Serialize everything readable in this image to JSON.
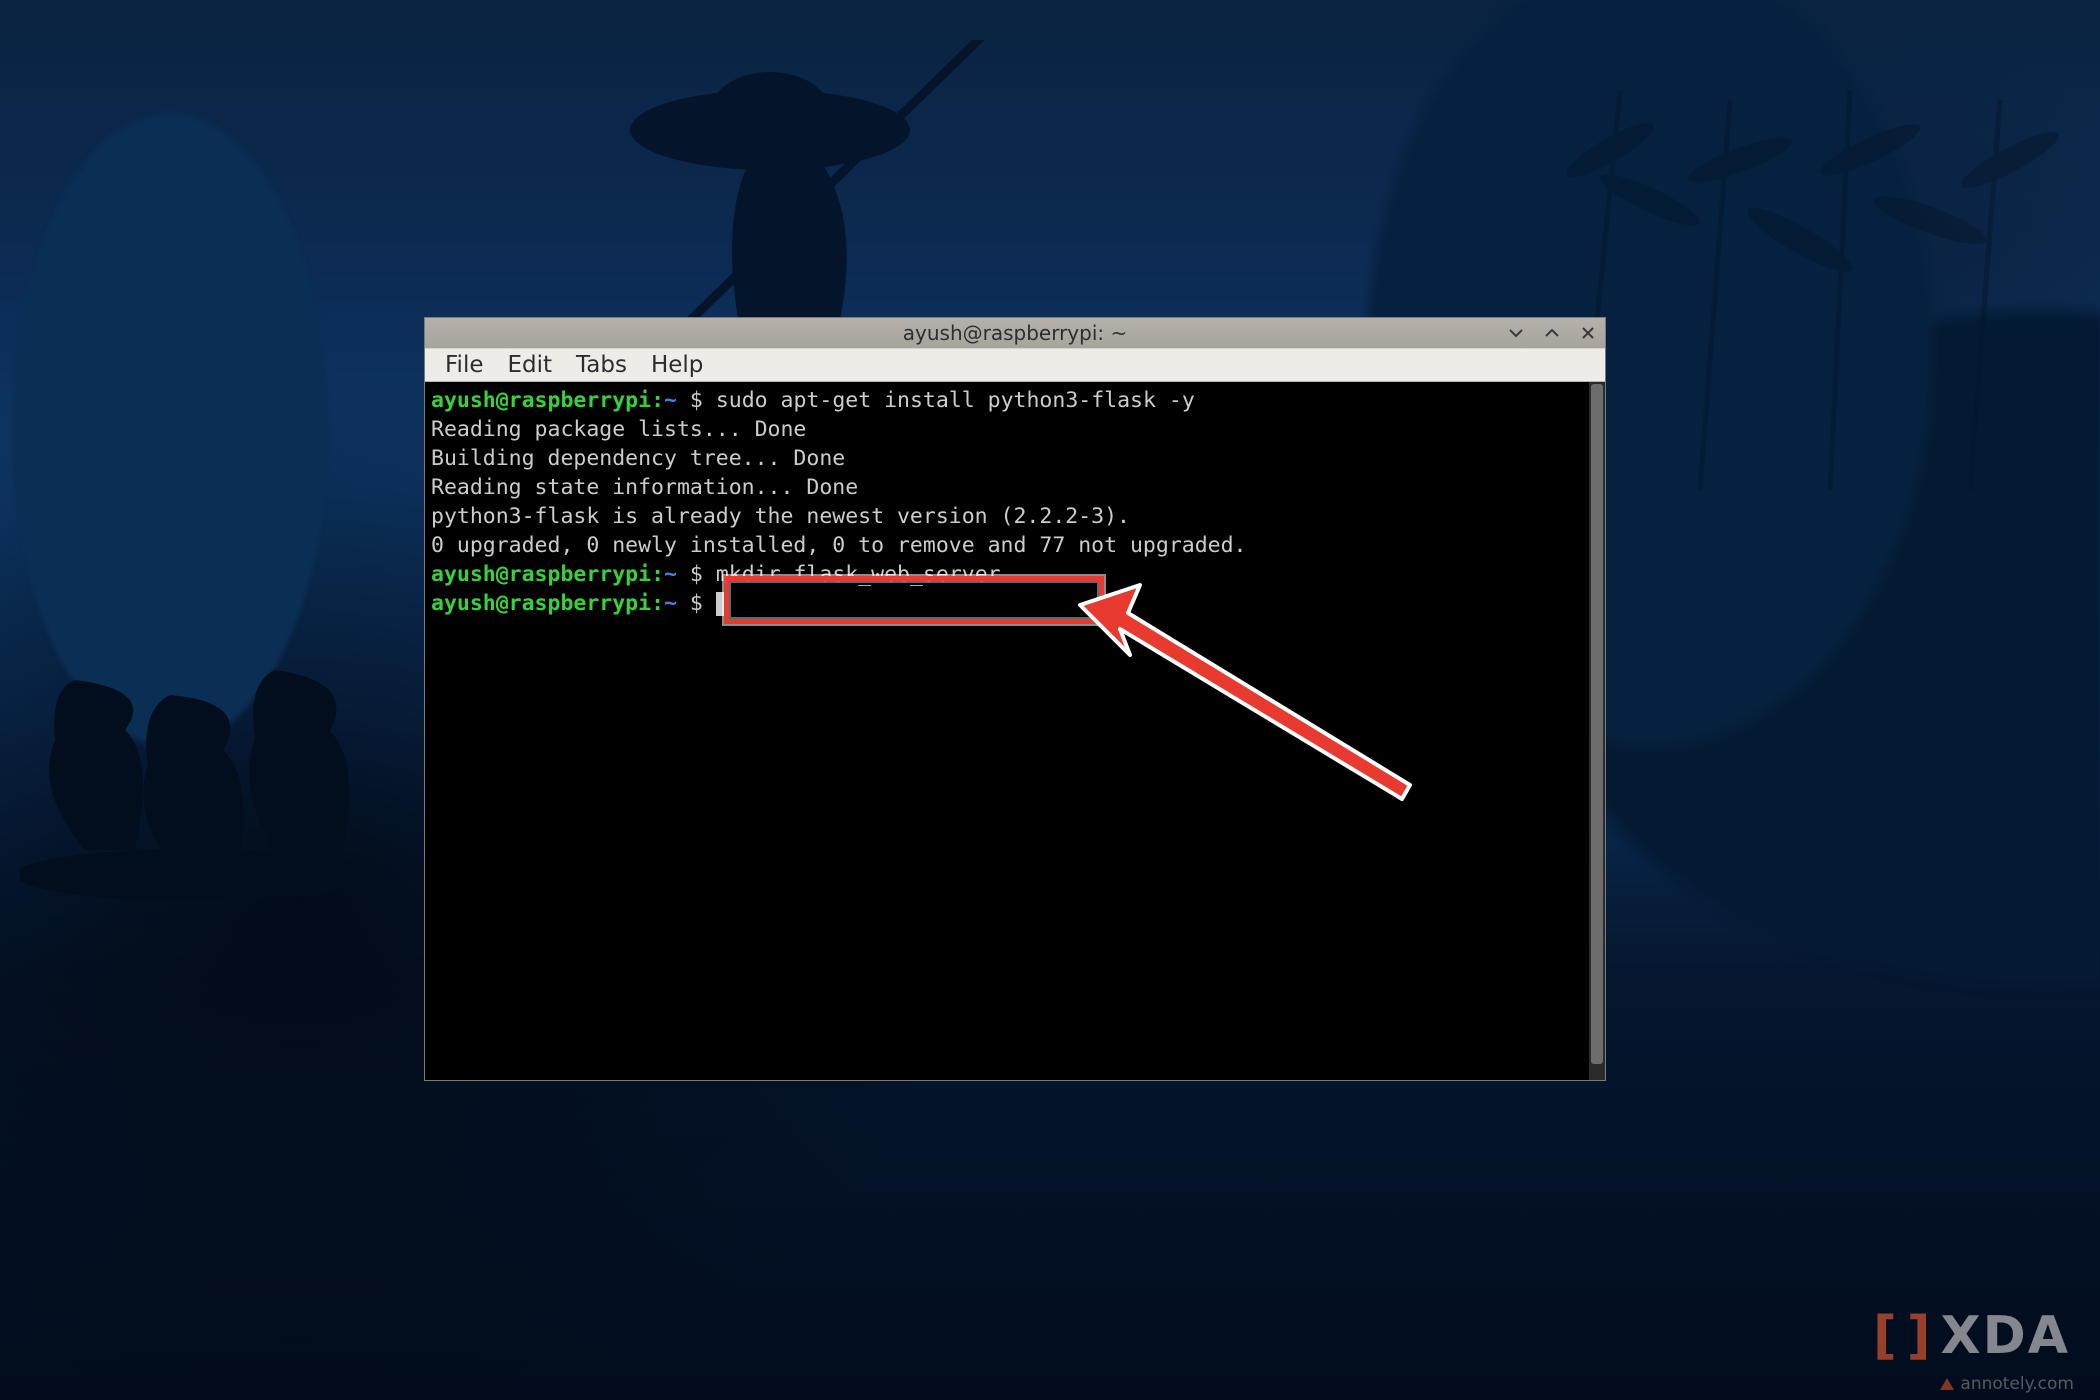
{
  "window": {
    "title": "ayush@raspberrypi: ~",
    "controls": {
      "minimize_icon": "minimize-icon",
      "maximize_icon": "maximize-icon",
      "close_icon": "close-icon"
    }
  },
  "menubar": {
    "items": [
      "File",
      "Edit",
      "Tabs",
      "Help"
    ]
  },
  "prompt": {
    "user_host": "ayush@raspberrypi",
    "separator": ":",
    "path": "~",
    "symbol": "$"
  },
  "terminal": {
    "lines": [
      {
        "type": "cmd",
        "text": "sudo apt-get install python3-flask -y"
      },
      {
        "type": "out",
        "text": "Reading package lists... Done"
      },
      {
        "type": "out",
        "text": "Building dependency tree... Done"
      },
      {
        "type": "out",
        "text": "Reading state information... Done"
      },
      {
        "type": "out",
        "text": "python3-flask is already the newest version (2.2.2-3)."
      },
      {
        "type": "out",
        "text": "0 upgraded, 0 newly installed, 0 to remove and 77 not upgraded."
      },
      {
        "type": "cmd",
        "text": "mkdir flask_web_server"
      },
      {
        "type": "cmd",
        "text": "",
        "cursor": true
      }
    ]
  },
  "annotation": {
    "highlighted_command": "mkdir flask_web_server",
    "box_color": "#e83a2f"
  },
  "watermarks": {
    "xda_bracket_left": "[",
    "xda_bracket_right": "]",
    "xda_text": "XDA",
    "annotely": "annotely.com"
  }
}
